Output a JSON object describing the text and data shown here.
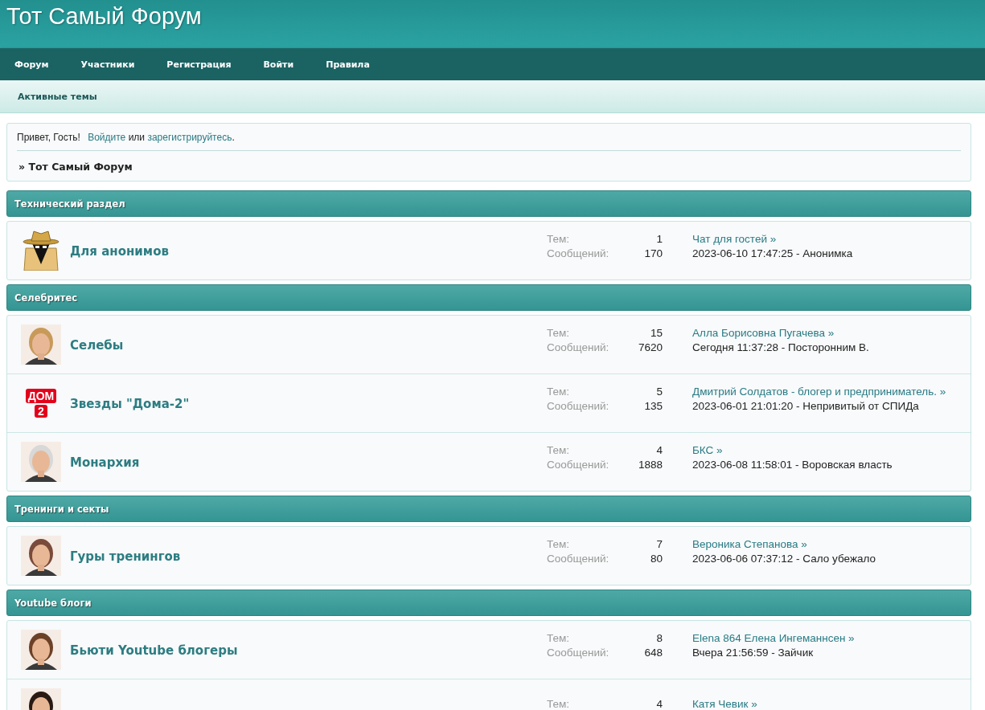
{
  "site_title": "Тот Самый Форум",
  "nav": [
    {
      "label": "Форум"
    },
    {
      "label": "Участники"
    },
    {
      "label": "Регистрация"
    },
    {
      "label": "Войти"
    },
    {
      "label": "Правила"
    }
  ],
  "subnav": [
    {
      "label": "Активные темы"
    }
  ],
  "welcome": {
    "greeting": "Привет, Гость!",
    "login_link": "Войдите",
    "or": "или",
    "register_link": "зарегистрируйтесь",
    "period": ".",
    "breadcrumb": "» Тот Самый Форум"
  },
  "categories": [
    {
      "title": "Технический раздел",
      "forums": [
        {
          "icon": {
            "kind": "spy"
          },
          "name": "Для анонимов",
          "topics_label": "Тем:",
          "topics": "1",
          "posts_label": "Сообщений:",
          "posts": "170",
          "last_topic": "Чат для гостей »",
          "last_post": "2023-06-10 17:47:25 - Анонимка"
        }
      ]
    },
    {
      "title": "Селебритес",
      "forums": [
        {
          "name": "Селебы",
          "topics_label": "Тем:",
          "topics": "15",
          "posts_label": "Сообщений:",
          "posts": "7620",
          "last_topic": "Алла Борисовна Пугачева »",
          "last_post": "Сегодня 11:37:28 - Посторонним В."
        },
        {
          "icon": {
            "kind": "logo",
            "text": "ДОМ",
            "subtext": "2"
          },
          "name": "Звезды \"Дома-2\"",
          "topics_label": "Тем:",
          "topics": "5",
          "posts_label": "Сообщений:",
          "posts": "135",
          "last_topic": "Дмитрий Солдатов - блогер и предприниматель. »",
          "last_post": "2023-06-01 21:01:20 - Непривитый от СПИДа"
        },
        {
          "name": "Монархия",
          "topics_label": "Тем:",
          "topics": "4",
          "posts_label": "Сообщений:",
          "posts": "1888",
          "last_topic": "БКС »",
          "last_post": "2023-06-08 11:58:01 - Воровская власть"
        }
      ]
    },
    {
      "title": "Тренинги и секты",
      "forums": [
        {
          "name": "Гуры тренингов",
          "topics_label": "Тем:",
          "topics": "7",
          "posts_label": "Сообщений:",
          "posts": "80",
          "last_topic": "Вероника Степанова »",
          "last_post": "2023-06-06 07:37:12 - Сало убежало"
        }
      ]
    },
    {
      "title": "Youtube блоги",
      "forums": [
        {
          "name": "Бьюти Youtube блогеры",
          "topics_label": "Тем:",
          "topics": "8",
          "posts_label": "Сообщений:",
          "posts": "648",
          "last_topic": "Elena 864 Елена Ингеманнсен »",
          "last_post": "Вчера 21:56:59 - Зайчик"
        },
        {
          "topics_label": "Тем:",
          "topics": "4",
          "last_topic": "Катя Чевик »"
        }
      ]
    }
  ]
}
